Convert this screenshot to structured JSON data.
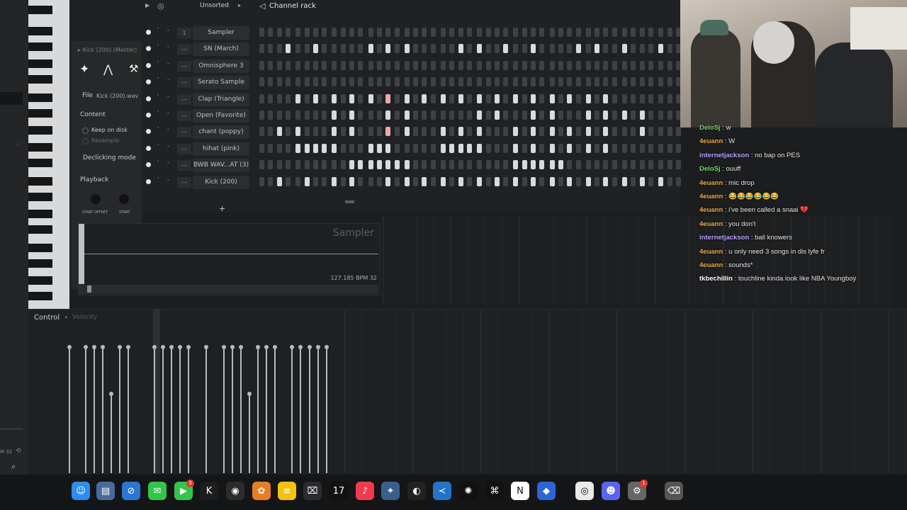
{
  "toolbar": {
    "unsorted": "Unsorted",
    "channel_rack_title": "Channel rack"
  },
  "channels": [
    {
      "num": "1",
      "name": "Sampler"
    },
    {
      "num": "---",
      "name": "SN (March)"
    },
    {
      "num": "---",
      "name": "Omnisphere 3"
    },
    {
      "num": "---",
      "name": "Serato Sample"
    },
    {
      "num": "---",
      "name": "Clap (Triangle)"
    },
    {
      "num": "---",
      "name": "Open (Favorite)"
    },
    {
      "num": "---",
      "name": "chant (poppy)"
    },
    {
      "num": "---",
      "name": "hihat (pink)"
    },
    {
      "num": "---",
      "name": "BWB WAV...AT (3)"
    },
    {
      "num": "---",
      "name": "Kick (200)"
    }
  ],
  "sampler": {
    "header": "Kick (200) (Master)",
    "file_label": "File",
    "file_value": "Kick (200).wav",
    "content_label": "Content",
    "keep_on_disk": "Keep on disk",
    "resample": "Resample",
    "declicking": "Declicking mode",
    "playback": "Playback",
    "start_offset": "START OFFSET",
    "start": "START",
    "wave_title": "Sampler",
    "bpm": "127.185 BPM 32"
  },
  "control": {
    "label": "Control",
    "velocity": "Velocity"
  },
  "side_readout": "M 32",
  "chat": [
    {
      "user": "DeloSj",
      "text": "w",
      "color": "#7dd36b"
    },
    {
      "user": "4euann",
      "text": "W",
      "color": "#f2a93b"
    },
    {
      "user": "internetjackson",
      "text": "no bap on PES",
      "color": "#b9a2ff"
    },
    {
      "user": "DeloSj",
      "text": "ouuff",
      "color": "#7dd36b"
    },
    {
      "user": "4euann",
      "text": "mic drop",
      "color": "#f2a93b"
    },
    {
      "user": "4euann",
      "text": "😂😂😂😂😂😂",
      "color": "#f2a93b"
    },
    {
      "user": "4euann",
      "text": "i've been called a snaai 💔",
      "color": "#f2a93b"
    },
    {
      "user": "4euann",
      "text": "you don't",
      "color": "#f2a93b"
    },
    {
      "user": "internetjackson",
      "text": "ball knowers",
      "color": "#b9a2ff"
    },
    {
      "user": "4euann",
      "text": "u only need 3 songs in dis lyfe fr",
      "color": "#f2a93b"
    },
    {
      "user": "4euann",
      "text": "sounds*",
      "color": "#f2a93b"
    },
    {
      "user": "tkbechillin",
      "text": "touchline kinda look like NBA Youngboy",
      "color": "#ffffff"
    }
  ],
  "dock": {
    "icons": [
      "finder-icon",
      "files-icon",
      "safari-icon",
      "messages-icon",
      "facetime-icon",
      "kick-icon",
      "obs-icon",
      "fl-studio-icon",
      "notes-icon",
      "capcut-icon",
      "tradingview-icon",
      "music-icon",
      "davinci-icon",
      "github-icon",
      "vscode-icon",
      "chatgpt-icon",
      "capcut2-icon",
      "notion-icon",
      "roblox-icon",
      "chrome-icon",
      "discord-icon",
      "settings-icon",
      "trash-icon"
    ],
    "badges": {
      "facetime": "3",
      "settings": "1"
    }
  }
}
